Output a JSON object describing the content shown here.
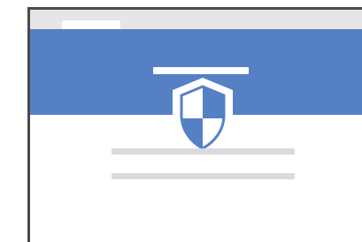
{
  "window": {
    "title": "",
    "tab_label": ""
  },
  "banner": {
    "icon": "security-shield-icon",
    "color": "#5581c4"
  },
  "colors": {
    "accent": "#5581c4",
    "frame": "#4a4a4a",
    "titlebar": "#e6e6e8",
    "placeholder": "#d9dadd"
  }
}
